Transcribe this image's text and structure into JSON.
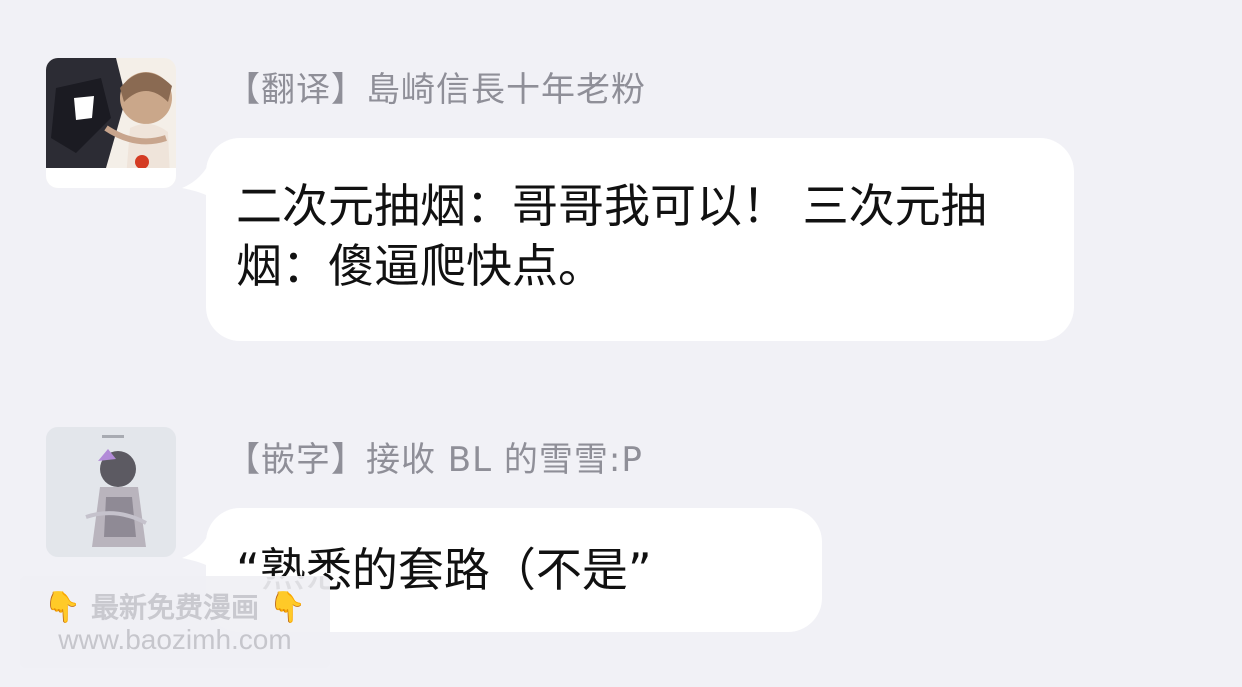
{
  "messages": [
    {
      "sender": "【翻译】島崎信長十年老粉",
      "text": "二次元抽烟：哥哥我可以！ 三次元抽烟：傻逼爬快点。",
      "avatar": "anime-couple-avatar"
    },
    {
      "sender": "【嵌字】接收 BL 的雪雪:P",
      "text": "“熟悉的套路（不是”",
      "avatar": "anime-character-avatar"
    }
  ],
  "watermark": {
    "line1": "最新免费漫画",
    "line2": "www.baozimh.com",
    "hand_icon": "👇",
    "icon": "pointing-down-hand-icon"
  },
  "colors": {
    "background": "#f1f1f6",
    "bubble": "#ffffff",
    "sender_text": "#8f8f98",
    "message_text": "#111111"
  }
}
